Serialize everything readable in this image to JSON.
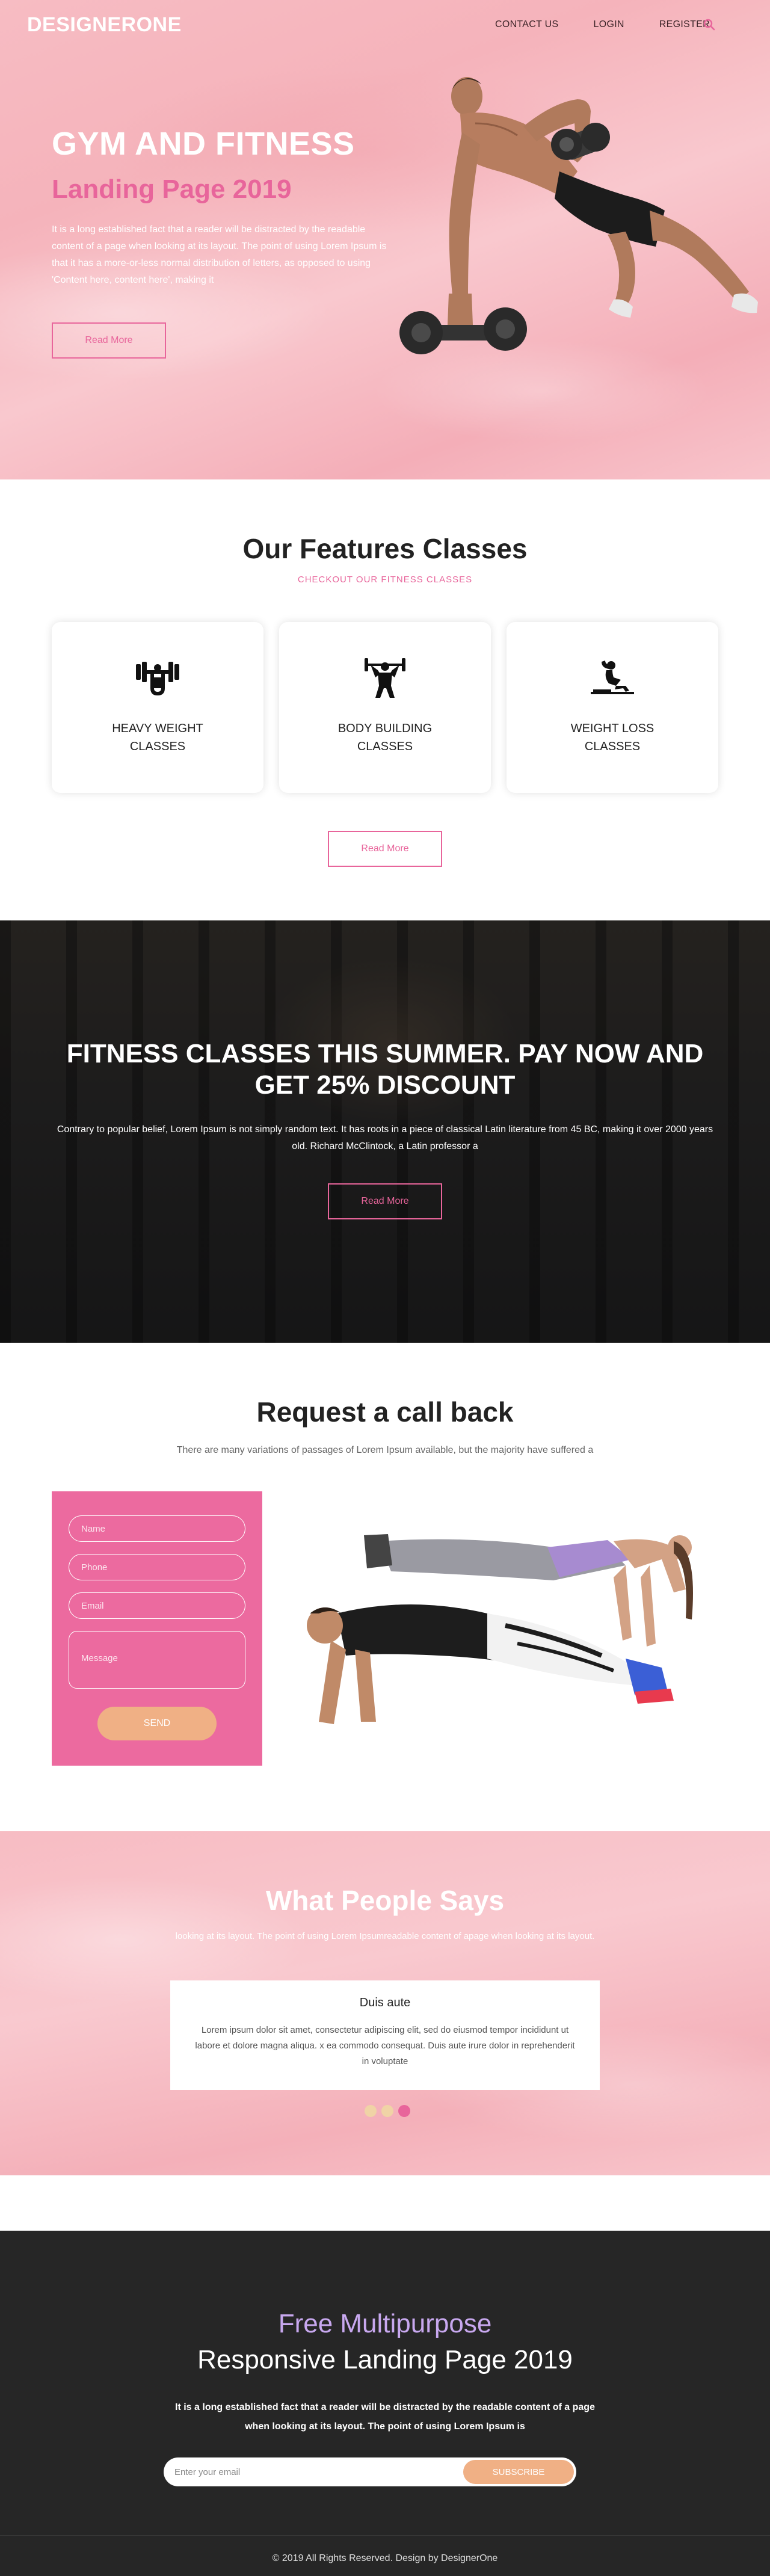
{
  "nav": {
    "logo": "DESIGNERONE",
    "links": [
      "CONTACT US",
      "LOGIN",
      "REGISTER"
    ],
    "search_icon": "search-icon"
  },
  "hero": {
    "title": "GYM AND FITNESS",
    "subtitle": "Landing Page 2019",
    "text": "It is a long established fact that a reader will be distracted by the readable content of a page when looking at its layout. The point of using Lorem Ipsum is that it has a more-or-less normal distribution of letters, as opposed to using 'Content here, content here', making it",
    "button": "Read More"
  },
  "features": {
    "title": "Our Features Classes",
    "subtitle": "CHECKOUT OUR FITNESS CLASSES",
    "cards": [
      {
        "line1": "HEAVY WEIGHT",
        "line2": "CLASSES",
        "icon": "weightlifter-icon"
      },
      {
        "line1": "BODY BUILDING",
        "line2": "CLASSES",
        "icon": "bodybuilder-icon"
      },
      {
        "line1": "WEIGHT LOSS",
        "line2": "CLASSES",
        "icon": "situp-icon"
      }
    ],
    "button": "Read More"
  },
  "promo": {
    "title_line1": "FITNESS CLASSES THIS SUMMER. PAY NOW AND",
    "title_line2": "GET 25% DISCOUNT",
    "text": "Contrary to popular belief, Lorem Ipsum is not simply random text. It has roots in a piece of classical Latin literature from 45 BC, making it over 2000 years old. Richard McClintock, a Latin professor a",
    "button": "Read More"
  },
  "callback": {
    "title": "Request a call back",
    "subtitle": "There are many variations of passages of Lorem Ipsum available, but the majority have suffered a",
    "placeholders": {
      "name": "Name",
      "phone": "Phone",
      "email": "Email",
      "message": "Message"
    },
    "button": "SEND"
  },
  "testimonials": {
    "title": "What People Says",
    "subtitle": "looking at its layout. The point of using Lorem Ipsumreadable content of apage when looking at its layout.",
    "name": "Duis aute",
    "quote": "Lorem ipsum dolor sit amet, consectetur adipiscing elit, sed do eiusmod tempor incididunt ut labore et dolore magna aliqua. x ea commodo consequat. Duis aute irure dolor in reprehenderit in voluptate",
    "dots": 3,
    "active_dot": 3
  },
  "cta": {
    "kicker": "Free Multipurpose",
    "title": "Responsive Landing Page 2019",
    "text": "It is a long established fact that a reader will be distracted by the readable content of a page when looking at its layout. The point of using Lorem Ipsum is",
    "email_placeholder": "Enter your email",
    "button": "SUBSCRIBE",
    "copyright": "© 2019 All Rights Reserved. Design by DesignerOne"
  },
  "colors": {
    "accent_pink": "#e8659b",
    "peach": "#f0b085",
    "lavender": "#c8a8ef",
    "dark": "#262626"
  }
}
